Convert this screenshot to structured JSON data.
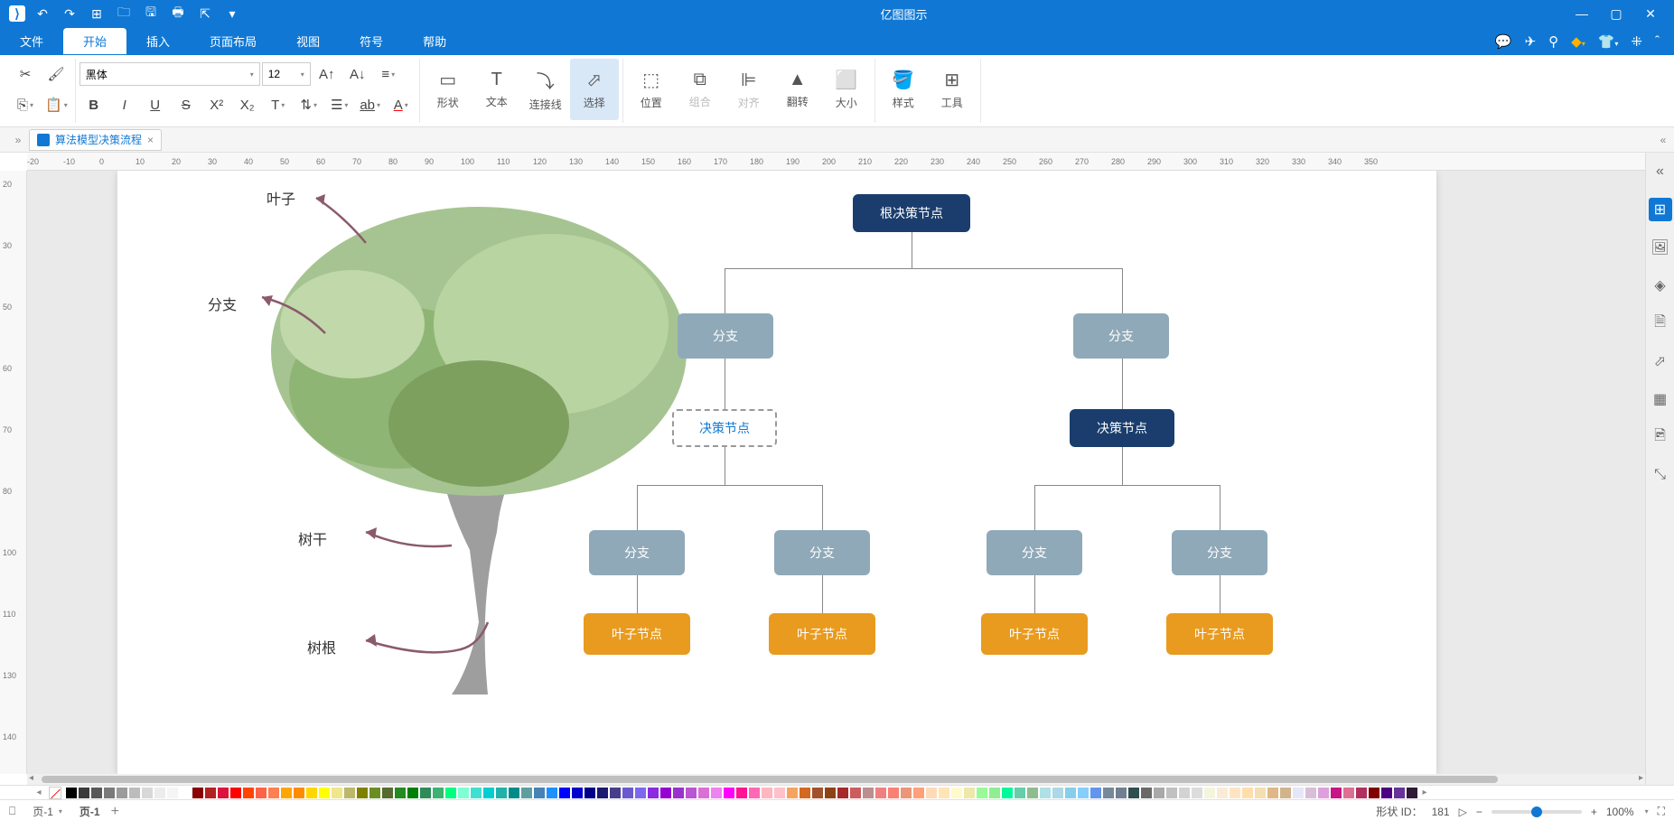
{
  "app": {
    "title": "亿图图示"
  },
  "qat": [
    "undo",
    "redo",
    "new",
    "open",
    "save",
    "print",
    "export"
  ],
  "menu": {
    "tabs": [
      "文件",
      "开始",
      "插入",
      "页面布局",
      "视图",
      "符号",
      "帮助"
    ],
    "active": 1
  },
  "ribbon": {
    "font_name": "黑体",
    "font_size": "12",
    "groups": {
      "shape": "形状",
      "text": "文本",
      "connector": "连接线",
      "select": "选择",
      "position": "位置",
      "group": "组合",
      "align": "对齐",
      "flip": "翻转",
      "size": "大小",
      "style": "样式",
      "tools": "工具"
    }
  },
  "doc_tab": {
    "name": "算法模型决策流程"
  },
  "ruler_h": [
    -20,
    -10,
    0,
    10,
    20,
    30,
    40,
    50,
    60,
    70,
    80,
    90,
    100,
    110,
    120,
    130,
    140,
    150,
    160,
    170,
    180,
    190,
    200,
    210,
    220,
    230,
    240,
    250,
    260,
    270,
    280,
    290,
    300,
    310,
    320,
    330,
    340,
    350
  ],
  "ruler_v": [
    20,
    30,
    50,
    60,
    70,
    80,
    100,
    110,
    130,
    140
  ],
  "tree_labels": {
    "leaf": "叶子",
    "branch": "分支",
    "trunk": "树干",
    "root": "树根"
  },
  "diagram": {
    "root": "根决策节点",
    "branch1": "分支",
    "branch2": "分支",
    "decision1": "决策节点",
    "decision2": "决策节点",
    "b3": "分支",
    "b4": "分支",
    "b5": "分支",
    "b6": "分支",
    "leaf1": "叶子节点",
    "leaf2": "叶子节点",
    "leaf3": "叶子节点",
    "leaf4": "叶子节点"
  },
  "right_panel": [
    "expand",
    "shapes",
    "image",
    "layers",
    "page",
    "chart",
    "table",
    "clipart",
    "random"
  ],
  "colorbar": [
    "#000000",
    "#3b3b3b",
    "#595959",
    "#7a7a7a",
    "#9b9b9b",
    "#bcbcbc",
    "#d8d8d8",
    "#ececec",
    "#f5f5f5",
    "#ffffff",
    "#8b0000",
    "#b22222",
    "#dc143c",
    "#ff0000",
    "#ff4500",
    "#ff6347",
    "#ff7f50",
    "#ffa500",
    "#ff8c00",
    "#ffd700",
    "#ffff00",
    "#f0e68c",
    "#bdb76b",
    "#808000",
    "#6b8e23",
    "#556b2f",
    "#228b22",
    "#008000",
    "#2e8b57",
    "#3cb371",
    "#00ff7f",
    "#7fffd4",
    "#40e0d0",
    "#00ced1",
    "#20b2aa",
    "#008b8b",
    "#5f9ea0",
    "#4682b4",
    "#1e90ff",
    "#0000ff",
    "#0000cd",
    "#00008b",
    "#191970",
    "#483d8b",
    "#6a5acd",
    "#7b68ee",
    "#8a2be2",
    "#9400d3",
    "#9932cc",
    "#ba55d3",
    "#da70d6",
    "#ee82ee",
    "#ff00ff",
    "#ff1493",
    "#ff69b4",
    "#ffb6c1",
    "#ffc0cb",
    "#f4a460",
    "#d2691e",
    "#a0522d",
    "#8b4513",
    "#a52a2a",
    "#cd5c5c",
    "#bc8f8f",
    "#f08080",
    "#fa8072",
    "#e9967a",
    "#ffa07a",
    "#ffdab9",
    "#ffe4b5",
    "#fffacd",
    "#eee8aa",
    "#98fb98",
    "#90ee90",
    "#00fa9a",
    "#66cdaa",
    "#8fbc8f",
    "#b0e0e6",
    "#add8e6",
    "#87ceeb",
    "#87cefa",
    "#6495ed",
    "#778899",
    "#708090",
    "#2f4f4f",
    "#696969",
    "#a9a9a9",
    "#c0c0c0",
    "#d3d3d3",
    "#dcdcdc",
    "#f5f5dc",
    "#faebd7",
    "#ffe4c4",
    "#ffdead",
    "#f5deb3",
    "#deb887",
    "#d2b48c",
    "#e6e6fa",
    "#d8bfd8",
    "#dda0dd",
    "#c71585",
    "#db7093",
    "#b03060",
    "#800000",
    "#4b0082",
    "#663399",
    "#301934"
  ],
  "statusbar": {
    "page_dropdown": "页-1",
    "page_label": "页-1",
    "shape_id_label": "形状 ID：",
    "shape_id": "181",
    "zoom": "100%"
  }
}
